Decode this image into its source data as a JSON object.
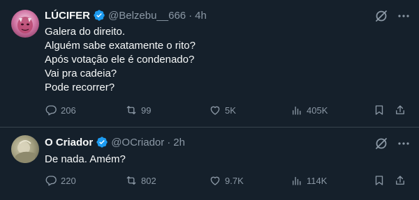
{
  "colors": {
    "background": "#15202b",
    "text_primary": "#f7f9f9",
    "text_secondary": "#8b98a5",
    "verified_badge": "#1d9bf0",
    "divider": "#38444d"
  },
  "tweets": [
    {
      "author_name": "LÚCIFER",
      "handle": "@Belzebu__666",
      "separator": "·",
      "time": "4h",
      "text_lines": [
        "Galera do direito.",
        "Alguém sabe exatamente o rito?",
        "Após votação ele é condenado?",
        "Vai pra cadeia?",
        "Pode recorrer?"
      ],
      "replies": "206",
      "retweets": "99",
      "likes": "5K",
      "views": "405K",
      "icons": [
        "reply-icon",
        "retweet-icon",
        "like-icon",
        "views-icon",
        "bookmark-icon",
        "share-icon",
        "grok-icon",
        "more-icon",
        "verified-icon"
      ]
    },
    {
      "author_name": "O Criador",
      "handle": "@OCriador",
      "separator": "·",
      "time": "2h",
      "text_lines": [
        "De nada. Amém?"
      ],
      "replies": "220",
      "retweets": "802",
      "likes": "9.7K",
      "views": "114K",
      "icons": [
        "reply-icon",
        "retweet-icon",
        "like-icon",
        "views-icon",
        "bookmark-icon",
        "share-icon",
        "grok-icon",
        "more-icon",
        "verified-icon"
      ]
    }
  ]
}
